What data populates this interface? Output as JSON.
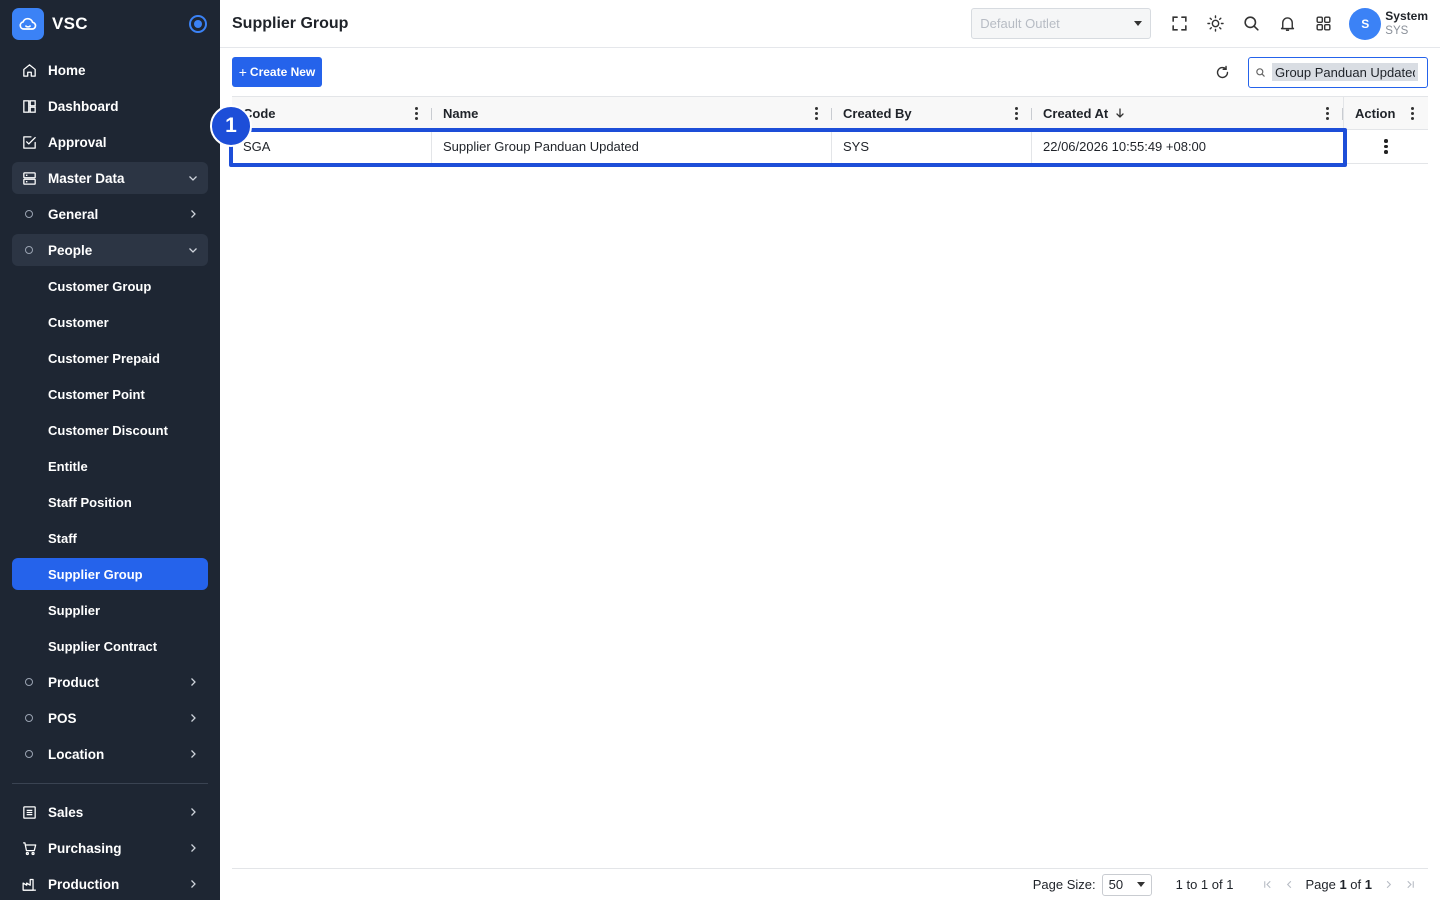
{
  "brand": {
    "name": "VSC"
  },
  "sidebar": {
    "items": [
      {
        "label": "Home",
        "icon": "home-icon"
      },
      {
        "label": "Dashboard",
        "icon": "dashboard-icon"
      },
      {
        "label": "Approval",
        "icon": "approval-icon"
      },
      {
        "label": "Master Data",
        "icon": "database-icon"
      },
      {
        "label": "General"
      },
      {
        "label": "People"
      },
      {
        "label": "Customer Group"
      },
      {
        "label": "Customer"
      },
      {
        "label": "Customer Prepaid"
      },
      {
        "label": "Customer Point"
      },
      {
        "label": "Customer Discount"
      },
      {
        "label": "Entitle"
      },
      {
        "label": "Staff Position"
      },
      {
        "label": "Staff"
      },
      {
        "label": "Supplier Group"
      },
      {
        "label": "Supplier"
      },
      {
        "label": "Supplier Contract"
      },
      {
        "label": "Product"
      },
      {
        "label": "POS"
      },
      {
        "label": "Location"
      },
      {
        "label": "Sales",
        "icon": "sales-icon"
      },
      {
        "label": "Purchasing",
        "icon": "cart-icon"
      },
      {
        "label": "Production",
        "icon": "factory-icon"
      }
    ]
  },
  "header": {
    "title": "Supplier Group",
    "outlet_placeholder": "Default Outlet",
    "user": {
      "initial": "S",
      "name": "System",
      "code": "SYS"
    }
  },
  "toolbar": {
    "create_label": "Create New",
    "search_value": "Group Panduan Updated"
  },
  "grid": {
    "columns": [
      "Code",
      "Name",
      "Created By",
      "Created At",
      "Action"
    ],
    "rows": [
      {
        "code": "SGA",
        "name": "Supplier Group Panduan Updated",
        "created_by": "SYS",
        "created_at": "22/06/2026 10:55:49 +08:00"
      }
    ]
  },
  "footer": {
    "page_size_label": "Page Size:",
    "page_size": "50",
    "range": "1 to 1 of 1",
    "page_word": "Page",
    "page_current": "1",
    "of_word": "of",
    "page_total": "1"
  },
  "annotation": {
    "step": "1"
  },
  "colors": {
    "sidebar_bg": "#1e2633",
    "accent": "#2563eb",
    "highlight": "#1d4ed8"
  }
}
